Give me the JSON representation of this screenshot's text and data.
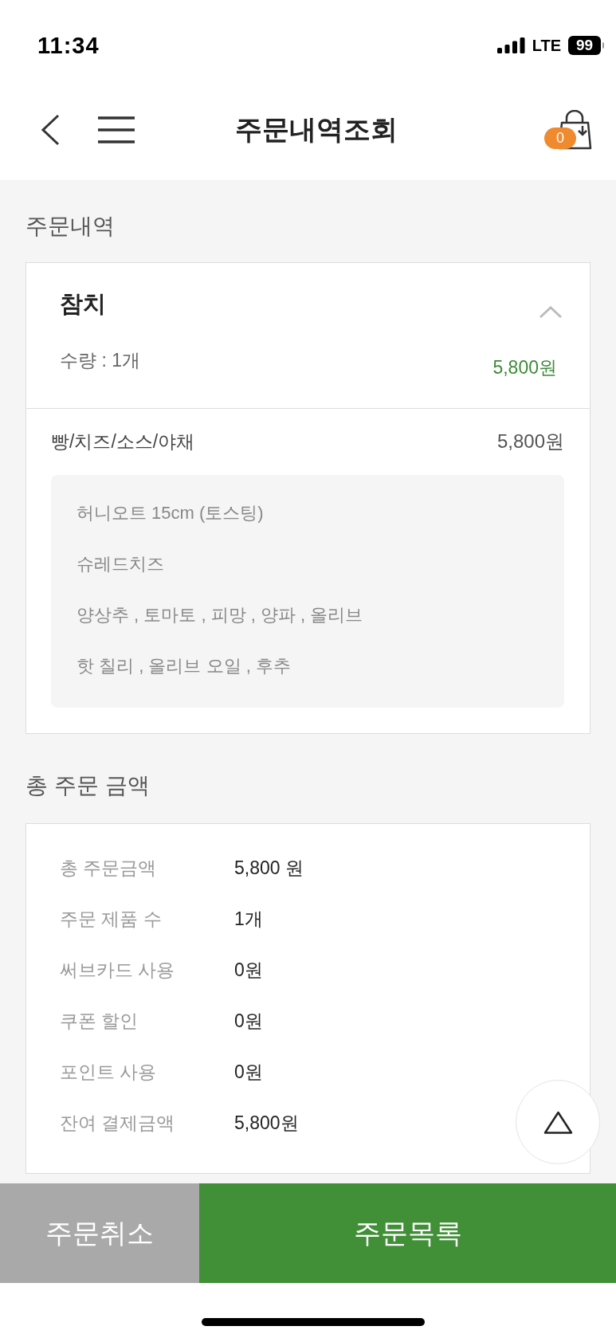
{
  "status_bar": {
    "time": "11:34",
    "network": "LTE",
    "battery": "99"
  },
  "header": {
    "title": "주문내역조회",
    "cart_count": "0"
  },
  "order_section": {
    "heading": "주문내역",
    "items": [
      {
        "name": "참치",
        "quantity": "수량 : 1개",
        "price": "5,800원",
        "expanded": true,
        "option_group": {
          "label": "빵/치즈/소스/야채",
          "price": "5,800원",
          "options": [
            "허니오트 15cm (토스팅)",
            "슈레드치즈",
            "양상추 , 토마토 , 피망 , 양파 , 올리브",
            "핫 칠리 , 올리브 오일 , 후추"
          ]
        }
      }
    ]
  },
  "total_section": {
    "heading": "총 주문 금액",
    "rows": [
      {
        "label": "총 주문금액",
        "value": "5,800 원"
      },
      {
        "label": "주문 제품 수",
        "value": "1개"
      },
      {
        "label": "써브카드 사용",
        "value": "0원"
      },
      {
        "label": "쿠폰 할인",
        "value": "0원"
      },
      {
        "label": "포인트 사용",
        "value": "0원"
      },
      {
        "label": "잔여 결제금액",
        "value": "5,800원"
      }
    ]
  },
  "buttons": [
    {
      "label": "주문취소",
      "kind": "secondary"
    },
    {
      "label": "주문목록",
      "kind": "primary"
    }
  ]
}
